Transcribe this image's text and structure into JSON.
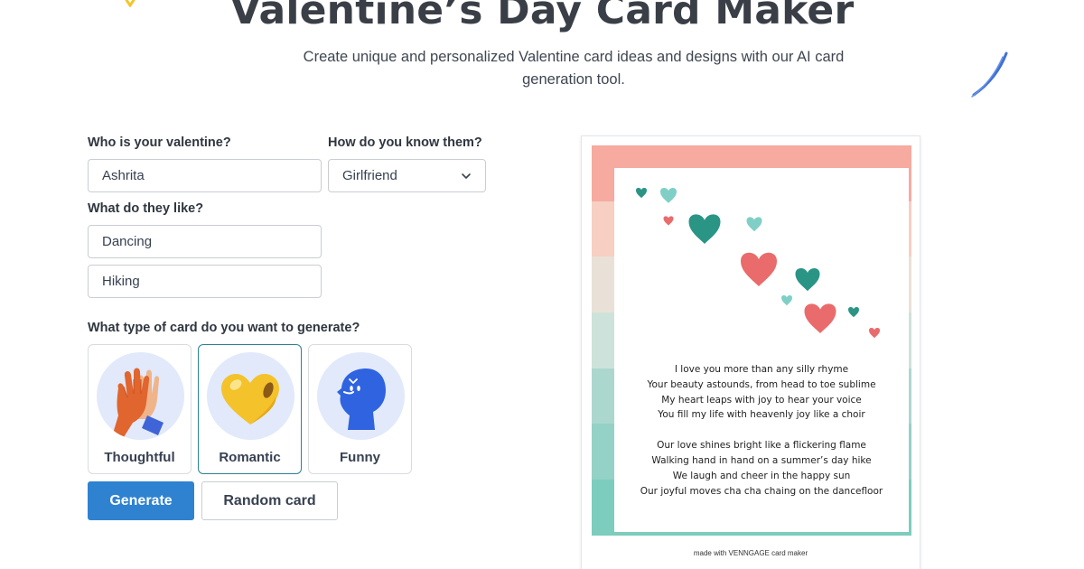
{
  "header": {
    "title": "Valentine’s Day Card Maker",
    "subtitle_line1": "Create unique and personalized Valentine card ideas and designs with our AI card",
    "subtitle_line2": "generation tool."
  },
  "form": {
    "valentine_label": "Who is your valentine?",
    "valentine_value": "Ashrita",
    "relation_label": "How do you know them?",
    "relation_value": "Girlfriend",
    "likes_label": "What do they like?",
    "like1_value": "Dancing",
    "like2_value": "Hiking",
    "card_type_label": "What type of card do you want to generate?",
    "card_types": [
      {
        "label": "Thoughtful",
        "icon": "high-five-icon"
      },
      {
        "label": "Romantic",
        "icon": "heart-icon"
      },
      {
        "label": "Funny",
        "icon": "laughing-head-icon"
      }
    ],
    "selected_card_type": "Romantic",
    "generate_label": "Generate",
    "random_label": "Random card"
  },
  "card": {
    "stanza1": [
      "I love you more than any silly rhyme",
      "Your beauty astounds, from head to toe sublime",
      "My heart leaps with joy to hear your voice",
      "You fill my life with heavenly joy like a choir"
    ],
    "stanza2": [
      "Our love shines bright like a flickering flame",
      "Walking hand in hand on a summer’s day hike",
      "We laugh and cheer in the happy sun",
      "Our joyful moves cha cha chaing on the dancefloor"
    ],
    "footer": "made with VENNGAGE card maker",
    "stripe_colors": [
      "#f6aaa0",
      "#f7cfc3",
      "#e9e1d7",
      "#cde2da",
      "#acd7cf",
      "#94d1c6",
      "#7ccdbd"
    ],
    "heart_colors": {
      "teal": "#2a9485",
      "light_teal": "#7fcfc6",
      "coral": "#ea6b6b"
    }
  },
  "colors": {
    "primary_button": "#2f82d0",
    "selected_border": "#2b8294",
    "icon_circle_bg": "#e1e9fb"
  }
}
